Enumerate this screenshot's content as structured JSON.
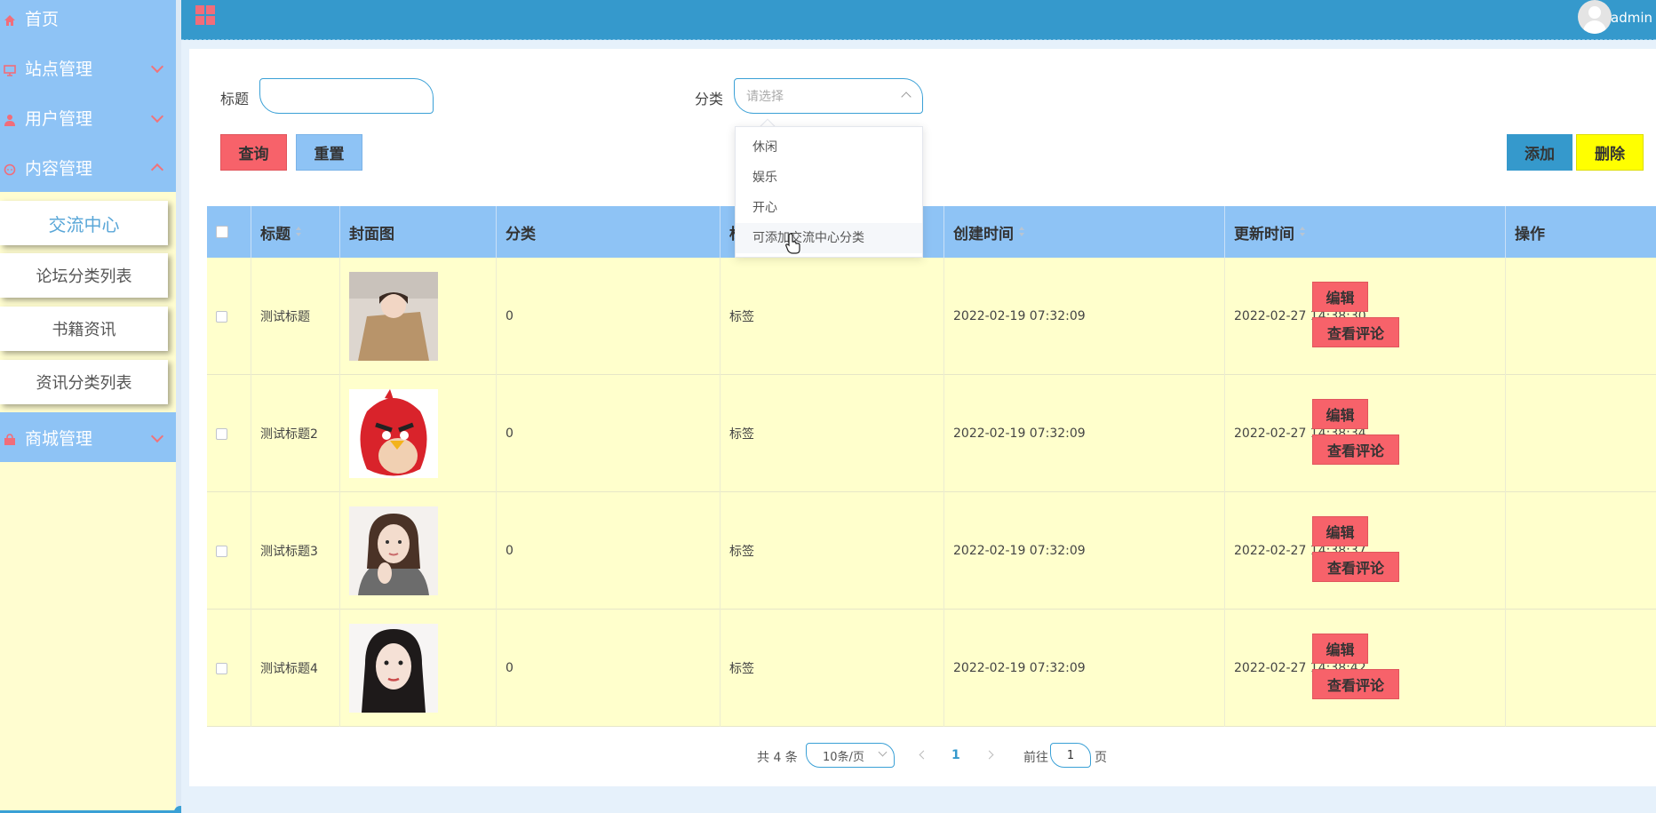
{
  "sidebar": {
    "home": "首页",
    "site_mgmt": "站点管理",
    "user_mgmt": "用户管理",
    "content_mgmt": "内容管理",
    "submenu": [
      "交流中心",
      "论坛分类列表",
      "书籍资讯",
      "资讯分类列表"
    ],
    "mall_mgmt": "商城管理"
  },
  "header": {
    "user": "admin"
  },
  "search": {
    "title_label": "标题",
    "title_value": "",
    "category_label": "分类",
    "category_placeholder": "请选择"
  },
  "dropdown": {
    "options": [
      "休闲",
      "娱乐",
      "开心",
      "可添加交流中心分类"
    ]
  },
  "buttons": {
    "query": "查询",
    "reset": "重置",
    "add": "添加",
    "delete": "删除"
  },
  "table": {
    "headers": {
      "title": "标题",
      "cover": "封面图",
      "category": "分类",
      "tag": "标",
      "created": "创建时间",
      "updated": "更新时间",
      "actions": "操作"
    },
    "rows": [
      {
        "title": "测试标题",
        "category": "0",
        "tag": "标签",
        "created": "2022-02-19 07:32:09",
        "updated": "2022-02-27 14:38:30"
      },
      {
        "title": "测试标题2",
        "category": "0",
        "tag": "标签",
        "created": "2022-02-19 07:32:09",
        "updated": "2022-02-27 14:38:34"
      },
      {
        "title": "测试标题3",
        "category": "0",
        "tag": "标签",
        "created": "2022-02-19 07:32:09",
        "updated": "2022-02-27 14:38:37"
      },
      {
        "title": "测试标题4",
        "category": "0",
        "tag": "标签",
        "created": "2022-02-19 07:32:09",
        "updated": "2022-02-27 14:38:42"
      }
    ],
    "edit_label": "编辑",
    "comments_label": "查看评论"
  },
  "pagination": {
    "total": "共 4 条",
    "page_size": "10条/页",
    "current_page": "1",
    "goto_prefix": "前往",
    "goto_value": "1",
    "goto_suffix": "页"
  },
  "colors": {
    "sidebar_menu": "#8ec3f5",
    "sidebar_bg": "#fffdd0",
    "header": "#3599cc",
    "danger": "#f7626a",
    "warning": "#ffff00",
    "row_bg": "#ffffcc"
  }
}
